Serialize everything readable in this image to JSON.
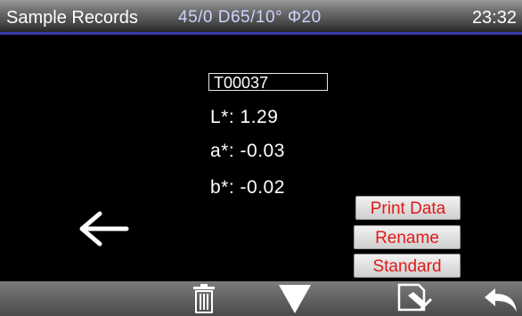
{
  "header": {
    "title": "Sample Records",
    "mode": "45/0  D65/10°  Φ20",
    "time": "23:32"
  },
  "record": {
    "sample_id": "T00037",
    "L": "L*: 1.29",
    "a": "a*: -0.03",
    "b": "b*: -0.02"
  },
  "actions": {
    "print": "Print Data",
    "rename": "Rename",
    "standard": "Standard"
  },
  "icons": {
    "back": "left-arrow-icon",
    "delete": "trash-icon",
    "next": "triangle-down-icon",
    "edit": "document-edit-icon",
    "return": "return-arrow-icon"
  },
  "colors": {
    "background": "#000000",
    "action_text": "#e01a1a",
    "header_rule": "#3a3aa8"
  }
}
